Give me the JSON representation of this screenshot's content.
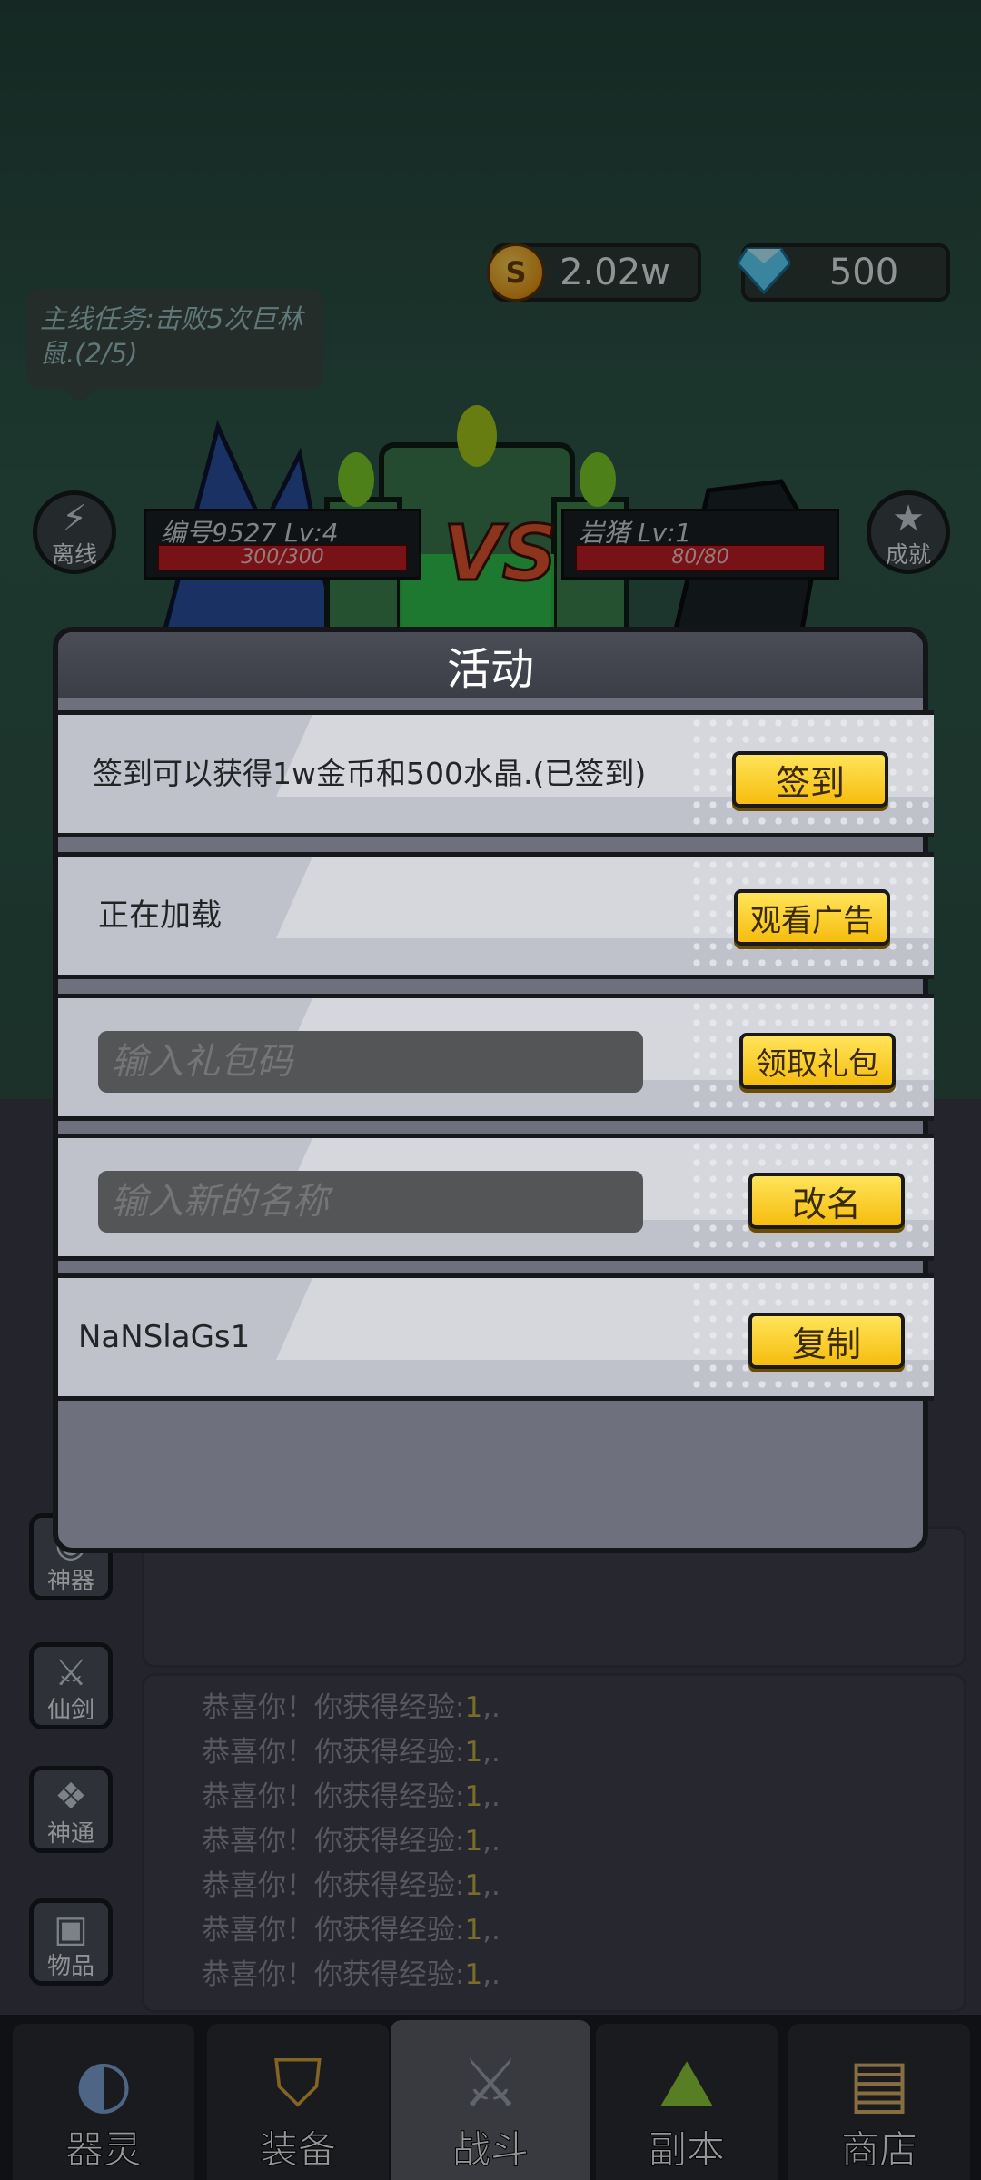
{
  "currency": {
    "gold": "2.02w",
    "gold_symbol": "S",
    "crystal": "500"
  },
  "quest": {
    "text": "主线任务:击败5次巨林鼠.(2/5)"
  },
  "left_icons": {
    "offline": "离线",
    "artifact": "神器",
    "sword": "仙剑",
    "divine": "神通",
    "items": "物品"
  },
  "right_icons": {
    "achievement": "成就"
  },
  "battle": {
    "player": {
      "name": "编号9527 Lv:4",
      "hp": "300/300"
    },
    "enemy": {
      "name": "岩猪 Lv:1",
      "hp": "80/80"
    },
    "vs_text": "VS"
  },
  "modal": {
    "title": "活动",
    "rows": [
      {
        "text": "签到可以获得1w金币和500水晶.(已签到)",
        "button": "签到"
      },
      {
        "text": "正在加载",
        "button": "观看广告"
      },
      {
        "placeholder": "输入礼包码",
        "button": "领取礼包"
      },
      {
        "placeholder": "输入新的名称",
        "button": "改名"
      },
      {
        "text": "NaNSlaGs1",
        "button": "复制"
      }
    ]
  },
  "log": {
    "lines": [
      {
        "prefix": "恭喜你！你获得经验:",
        "value": "1",
        "suffix": ",."
      },
      {
        "prefix": "恭喜你！你获得经验:",
        "value": "1",
        "suffix": ",."
      },
      {
        "prefix": "恭喜你！你获得经验:",
        "value": "1",
        "suffix": ",."
      },
      {
        "prefix": "恭喜你！你获得经验:",
        "value": "1",
        "suffix": ",."
      },
      {
        "prefix": "恭喜你！你获得经验:",
        "value": "1",
        "suffix": ",."
      },
      {
        "prefix": "恭喜你！你获得经验:",
        "value": "1",
        "suffix": ",."
      },
      {
        "prefix": "恭喜你！你获得经验:",
        "value": "1",
        "suffix": ",."
      }
    ]
  },
  "nav": {
    "items": [
      {
        "label": "器灵",
        "icon": "spirit-icon"
      },
      {
        "label": "装备",
        "icon": "helmet-icon"
      },
      {
        "label": "战斗",
        "icon": "crossed-swords-icon",
        "active": true
      },
      {
        "label": "副本",
        "icon": "dungeon-icon"
      },
      {
        "label": "商店",
        "icon": "treasure-chest-icon"
      }
    ]
  },
  "colors": {
    "accent_yellow": "#f6bd0e",
    "hp_red": "#c11f24",
    "log_value": "#c6b143"
  }
}
